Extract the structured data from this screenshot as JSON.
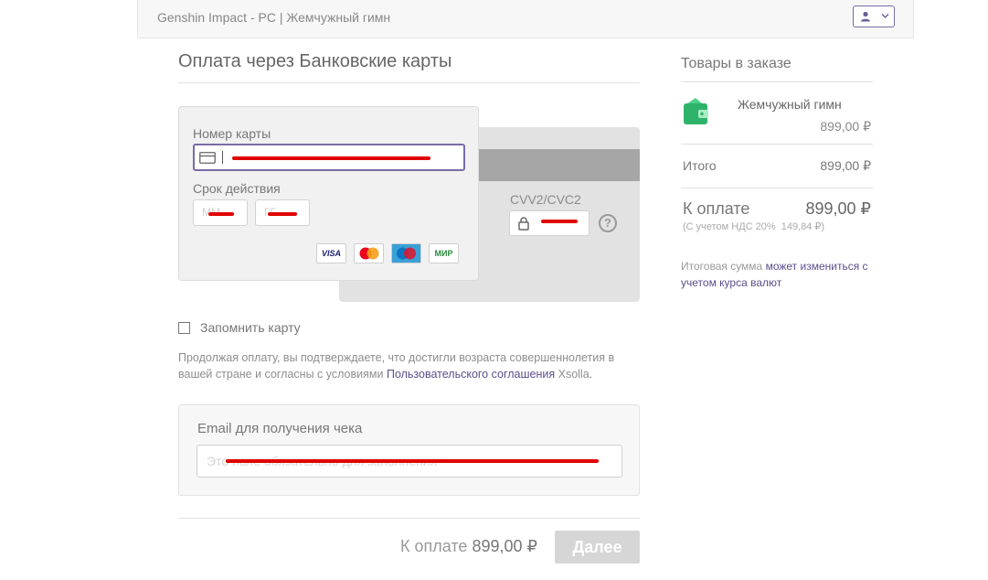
{
  "header": {
    "title": "Genshin Impact - PC | Жемчужный гимн",
    "user_icon": "user-icon",
    "chevron_icon": "chevron-down-icon"
  },
  "payment": {
    "title": "Оплата через Банковские карты",
    "card_number_label": "Номер карты",
    "expiry_label": "Срок действия",
    "expiry_month_placeholder": "ММ",
    "expiry_year_placeholder": "ГГ",
    "cvv_label": "CVV2/CVC2",
    "help_glyph": "?",
    "card_logos": [
      "VISA",
      "mastercard",
      "Maestro",
      "МИР"
    ],
    "remember_label": "Запомнить карту",
    "terms_text": "Продолжая оплату, вы подтверждаете, что достигли возраста совершеннолетия в вашей стране и согласны с условиями",
    "terms_link": "Пользовательского соглашения",
    "terms_suffix": "Xsolla."
  },
  "email": {
    "label": "Email для получения чека",
    "placeholder": "Это поле обязательно для заполнения"
  },
  "footer": {
    "total_label": "К оплате",
    "total_value": "899,00 ₽",
    "next_button": "Далее"
  },
  "summary": {
    "title": "Товары в заказе",
    "item_name": "Жемчужный гимн",
    "item_price": "899,00 ₽",
    "subtotal_label": "Итого",
    "subtotal_value": "899,00 ₽",
    "pay_label": "К оплате",
    "pay_value": "899,00 ₽",
    "vat_label": "(С учетом НДС 20%",
    "vat_value": "149,84 ₽)",
    "note_prefix": "Итоговая сумма",
    "note_link": "может измениться с учетом курса валют"
  },
  "colors": {
    "accent": "#7a6ba6",
    "link": "#5c4e8c",
    "redaction": "#e00000",
    "wallet_icon": "#2fb36a"
  }
}
